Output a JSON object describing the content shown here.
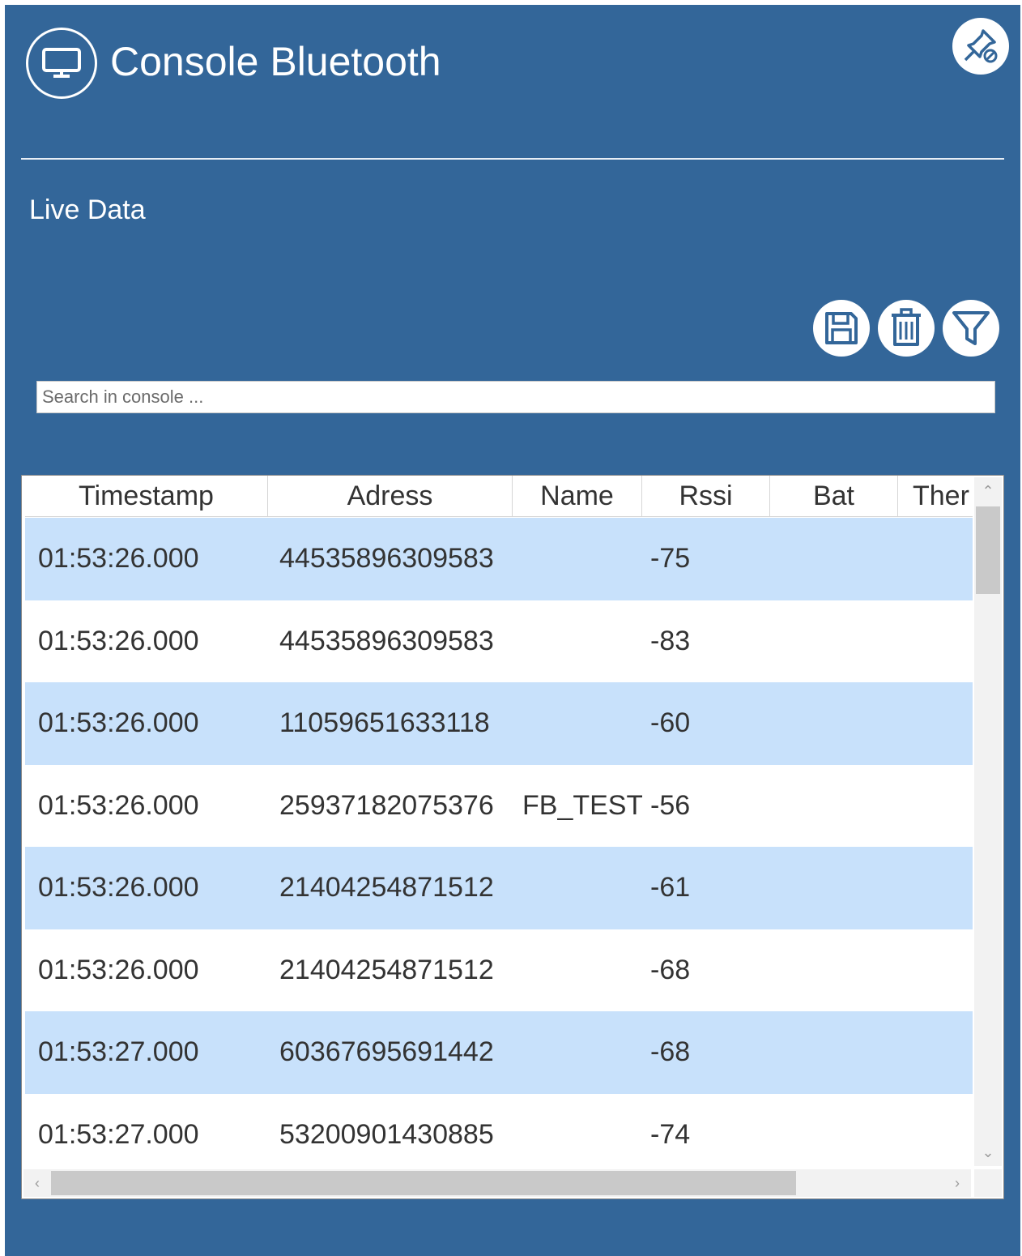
{
  "window": {
    "title": "Console Bluetooth",
    "app_icon": "monitor-icon",
    "pin_icon": "unpin-icon"
  },
  "section": {
    "title": "Live Data"
  },
  "toolbar": {
    "save_icon": "save-icon",
    "delete_icon": "trash-icon",
    "filter_icon": "filter-icon"
  },
  "search": {
    "placeholder": "Search in console ...",
    "value": ""
  },
  "table": {
    "columns": [
      "Timestamp",
      "Adress",
      "Name",
      "Rssi",
      "Bat",
      "Ther"
    ],
    "rows": [
      {
        "timestamp": "01:53:26.000",
        "address": "44535896309583",
        "name": "",
        "rssi": "-75",
        "bat": "",
        "ther": ""
      },
      {
        "timestamp": "01:53:26.000",
        "address": "44535896309583",
        "name": "",
        "rssi": "-83",
        "bat": "",
        "ther": ""
      },
      {
        "timestamp": "01:53:26.000",
        "address": "11059651633118",
        "name": "",
        "rssi": "-60",
        "bat": "",
        "ther": ""
      },
      {
        "timestamp": "01:53:26.000",
        "address": "25937182075376",
        "name": "FB_TEST",
        "rssi": "-56",
        "bat": "",
        "ther": ""
      },
      {
        "timestamp": "01:53:26.000",
        "address": "21404254871512",
        "name": "",
        "rssi": "-61",
        "bat": "",
        "ther": ""
      },
      {
        "timestamp": "01:53:26.000",
        "address": "21404254871512",
        "name": "",
        "rssi": "-68",
        "bat": "",
        "ther": ""
      },
      {
        "timestamp": "01:53:27.000",
        "address": "60367695691442",
        "name": "",
        "rssi": "-68",
        "bat": "",
        "ther": ""
      },
      {
        "timestamp": "01:53:27.000",
        "address": "53200901430885",
        "name": "",
        "rssi": "-74",
        "bat": "",
        "ther": ""
      }
    ]
  },
  "colors": {
    "panel": "#336699",
    "row_alt": "#c8e1fb",
    "text": "#333333"
  }
}
